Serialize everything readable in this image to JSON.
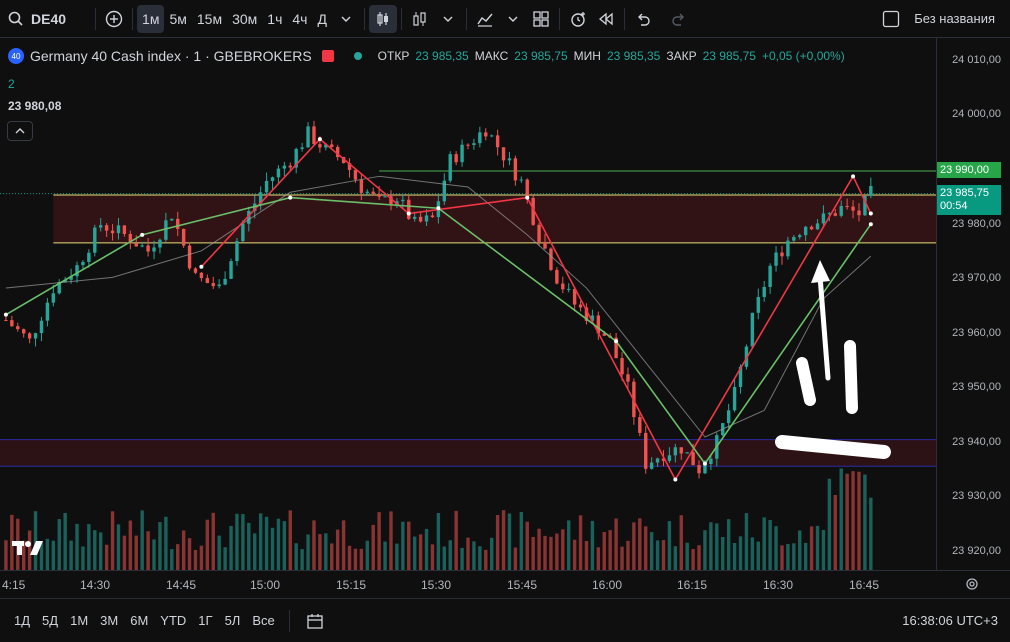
{
  "toolbar": {
    "symbol": "DE40",
    "intervals": [
      "1м",
      "5м",
      "15м",
      "30м",
      "1ч",
      "4ч",
      "Д"
    ],
    "active_interval": "1м",
    "layout_name": "Без названия"
  },
  "legend": {
    "badge": "40",
    "title": "Germany 40 Cash index · 1 · GBEBROKERS",
    "open_label": "ОТКР",
    "open_value": "23 985,35",
    "high_label": "МАКС",
    "high_value": "23 985,75",
    "low_label": "МИН",
    "low_value": "23 985,35",
    "close_label": "ЗАКР",
    "close_value": "23 985,75",
    "change": "+0,05 (+0,00%)",
    "indicator_count": "2",
    "indicator_value": "23 980,08"
  },
  "price_axis": {
    "labels": [
      "24 010,00",
      "24 000,00",
      "23 990,00",
      "23 985,75",
      "23 980,00",
      "23 970,00",
      "23 960,00",
      "23 950,00",
      "23 940,00",
      "23 930,00",
      "23 920,00"
    ],
    "tag_green": "23 990,00",
    "tag_price": "23 985,75",
    "tag_countdown": "00:54"
  },
  "time_axis": {
    "labels": [
      "4:15",
      "14:30",
      "14:45",
      "15:00",
      "15:15",
      "15:30",
      "15:45",
      "16:00",
      "16:15",
      "16:30",
      "16:45"
    ]
  },
  "bottom": {
    "ranges": [
      "1Д",
      "5Д",
      "1М",
      "3М",
      "6М",
      "YTD",
      "1Г",
      "5Л",
      "Все"
    ],
    "clock": "16:38:06 UTC+3"
  },
  "colors": {
    "up": "#26a69a",
    "down": "#ef5350",
    "bg": "#0f0f0f",
    "zone": "#3a1418",
    "yellow": "#e5e07a",
    "blue": "#2a2aa5",
    "green_line": "#4caf50"
  },
  "chart_data": {
    "type": "candlestick",
    "x_range": [
      "14:11",
      "16:49"
    ],
    "y_range": [
      23915,
      24015
    ],
    "resistance_zone": [
      23976.5,
      23985.5
    ],
    "support_zone": [
      23934.5,
      23939.5
    ],
    "level_line": 23990,
    "close_path": [
      [
        "14:12",
        23962
      ],
      [
        "14:16",
        23958
      ],
      [
        "14:20",
        23968
      ],
      [
        "14:24",
        23972
      ],
      [
        "14:28",
        23980
      ],
      [
        "14:32",
        23978
      ],
      [
        "14:36",
        23975
      ],
      [
        "14:40",
        23982
      ],
      [
        "14:44",
        23970
      ],
      [
        "14:48",
        23968
      ],
      [
        "14:52",
        23980
      ],
      [
        "14:56",
        23988
      ],
      [
        "15:00",
        23992
      ],
      [
        "15:03",
        23997
      ],
      [
        "15:06",
        23994
      ],
      [
        "15:09",
        23992
      ],
      [
        "15:12",
        23987
      ],
      [
        "15:15",
        23984
      ],
      [
        "15:18",
        23985
      ],
      [
        "15:21",
        23980
      ],
      [
        "15:24",
        23981
      ],
      [
        "15:27",
        23992
      ],
      [
        "15:30",
        23995
      ],
      [
        "15:33",
        23998
      ],
      [
        "15:36",
        23993
      ],
      [
        "15:39",
        23988
      ],
      [
        "15:42",
        23978
      ],
      [
        "15:45",
        23970
      ],
      [
        "15:48",
        23965
      ],
      [
        "15:51",
        23962
      ],
      [
        "15:54",
        23958
      ],
      [
        "15:57",
        23949
      ],
      [
        "16:00",
        23935
      ],
      [
        "16:03",
        23937
      ],
      [
        "16:06",
        23938
      ],
      [
        "16:09",
        23934
      ],
      [
        "16:12",
        23939
      ],
      [
        "16:15",
        23948
      ],
      [
        "16:18",
        23962
      ],
      [
        "16:21",
        23972
      ],
      [
        "16:24",
        23977
      ],
      [
        "16:27",
        23980
      ],
      [
        "16:30",
        23981
      ],
      [
        "16:33",
        23983
      ],
      [
        "16:36",
        23982
      ],
      [
        "16:38",
        23985.75
      ]
    ],
    "ma_slow": [
      [
        "14:12",
        23968
      ],
      [
        "14:30",
        23970
      ],
      [
        "14:45",
        23975
      ],
      [
        "15:00",
        23986
      ],
      [
        "15:15",
        23989
      ],
      [
        "15:30",
        23987
      ],
      [
        "15:40",
        23978
      ],
      [
        "15:50",
        23968
      ],
      [
        "16:00",
        23954
      ],
      [
        "16:10",
        23940
      ],
      [
        "16:20",
        23945
      ],
      [
        "16:30",
        23966
      ],
      [
        "16:38",
        23974
      ]
    ],
    "zigzag_red": [
      [
        "14:45",
        23972
      ],
      [
        "15:05",
        23996
      ],
      [
        "15:20",
        23982
      ],
      [
        "15:40",
        23985
      ],
      [
        "16:05",
        23932
      ],
      [
        "16:35",
        23989
      ],
      [
        "16:38",
        23982
      ]
    ],
    "zigzag_green": [
      [
        "14:12",
        23963
      ],
      [
        "14:35",
        23978
      ],
      [
        "15:00",
        23985
      ],
      [
        "15:25",
        23983
      ],
      [
        "15:55",
        23958
      ],
      [
        "16:10",
        23935
      ],
      [
        "16:38",
        23980
      ]
    ]
  }
}
